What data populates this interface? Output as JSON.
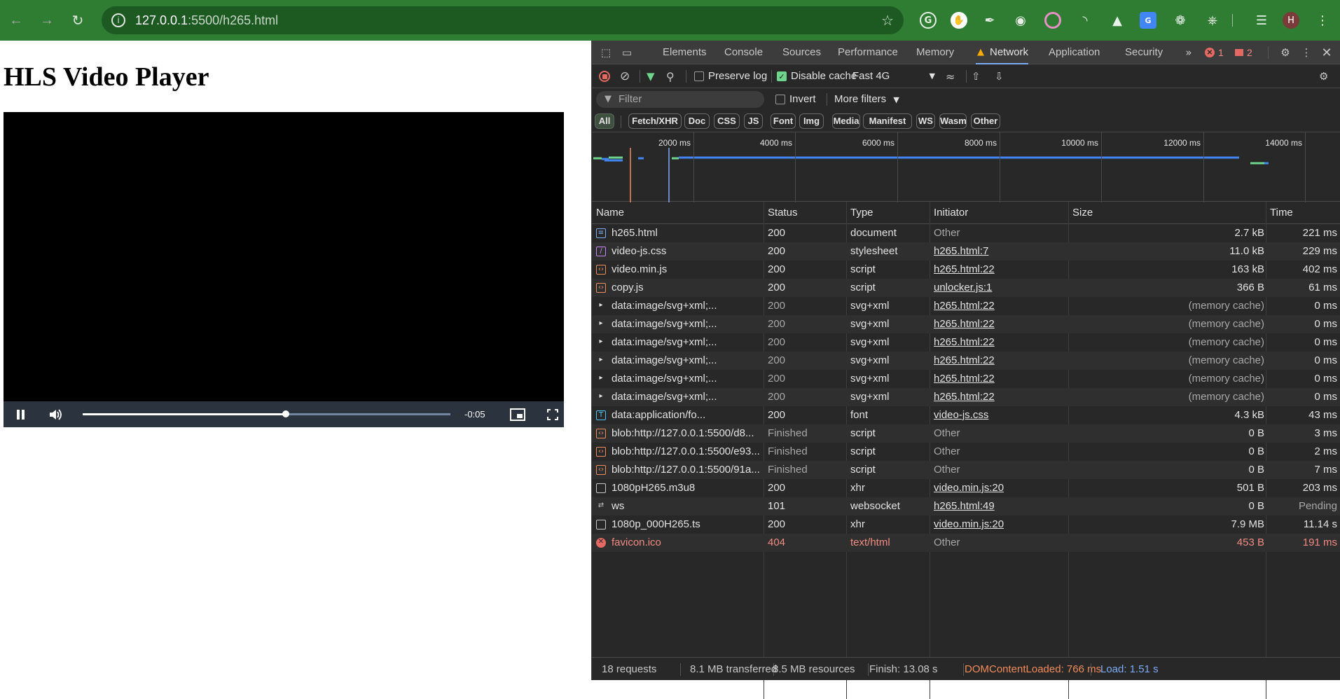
{
  "browser": {
    "url_host": "127.0.0.1",
    "url_path": ":5500/h265.html",
    "avatar_letter": "H"
  },
  "page": {
    "heading": "HLS Video Player",
    "video": {
      "time_remaining": "-0:05",
      "progress_fraction": 0.553
    }
  },
  "devtools": {
    "tabs": [
      "Elements",
      "Console",
      "Sources",
      "Performance",
      "Memory",
      "Network",
      "Application",
      "Security"
    ],
    "active_tab": "Network",
    "error_count": "1",
    "issue_count": "2",
    "toolbar": {
      "preserve_log": "Preserve log",
      "disable_cache": "Disable cache",
      "throttle": "Fast 4G"
    },
    "filter": {
      "placeholder": "Filter",
      "invert": "Invert",
      "more_filters": "More filters"
    },
    "type_filters": [
      "All",
      "Fetch/XHR",
      "Doc",
      "CSS",
      "JS",
      "Font",
      "Img",
      "Media",
      "Manifest",
      "WS",
      "Wasm",
      "Other"
    ],
    "overview_ticks": [
      "2000 ms",
      "4000 ms",
      "6000 ms",
      "8000 ms",
      "10000 ms",
      "12000 ms",
      "14000 ms"
    ],
    "columns": [
      "Name",
      "Status",
      "Type",
      "Initiator",
      "Size",
      "Time"
    ],
    "requests": [
      {
        "name": "h265.html",
        "status": "200",
        "type": "document",
        "initiator": "Other",
        "size": "2.7 kB",
        "time": "221 ms",
        "icon": "doc"
      },
      {
        "name": "video-js.css",
        "status": "200",
        "type": "stylesheet",
        "initiator": "h265.html:7",
        "size": "11.0 kB",
        "time": "229 ms",
        "icon": "css"
      },
      {
        "name": "video.min.js",
        "status": "200",
        "type": "script",
        "initiator": "h265.html:22",
        "size": "163 kB",
        "time": "402 ms",
        "icon": "js"
      },
      {
        "name": "copy.js",
        "status": "200",
        "type": "script",
        "initiator": "unlocker.js:1",
        "size": "366 B",
        "time": "61 ms",
        "icon": "js"
      },
      {
        "name": "data:image/svg+xml;...",
        "status": "200",
        "type": "svg+xml",
        "initiator": "h265.html:22",
        "size": "(memory cache)",
        "time": "0 ms",
        "icon": "svg"
      },
      {
        "name": "data:image/svg+xml;...",
        "status": "200",
        "type": "svg+xml",
        "initiator": "h265.html:22",
        "size": "(memory cache)",
        "time": "0 ms",
        "icon": "svg"
      },
      {
        "name": "data:image/svg+xml;...",
        "status": "200",
        "type": "svg+xml",
        "initiator": "h265.html:22",
        "size": "(memory cache)",
        "time": "0 ms",
        "icon": "svg"
      },
      {
        "name": "data:image/svg+xml;...",
        "status": "200",
        "type": "svg+xml",
        "initiator": "h265.html:22",
        "size": "(memory cache)",
        "time": "0 ms",
        "icon": "svg"
      },
      {
        "name": "data:image/svg+xml;...",
        "status": "200",
        "type": "svg+xml",
        "initiator": "h265.html:22",
        "size": "(memory cache)",
        "time": "0 ms",
        "icon": "svg"
      },
      {
        "name": "data:image/svg+xml;...",
        "status": "200",
        "type": "svg+xml",
        "initiator": "h265.html:22",
        "size": "(memory cache)",
        "time": "0 ms",
        "icon": "svg"
      },
      {
        "name": "data:application/fo...",
        "status": "200",
        "type": "font",
        "initiator": "video-js.css",
        "size": "4.3 kB",
        "time": "43 ms",
        "icon": "font"
      },
      {
        "name": "blob:http://127.0.0.1:5500/d8...",
        "status": "Finished",
        "type": "script",
        "initiator": "Other",
        "size": "0 B",
        "time": "3 ms",
        "icon": "js"
      },
      {
        "name": "blob:http://127.0.0.1:5500/e93...",
        "status": "Finished",
        "type": "script",
        "initiator": "Other",
        "size": "0 B",
        "time": "2 ms",
        "icon": "js"
      },
      {
        "name": "blob:http://127.0.0.1:5500/91a...",
        "status": "Finished",
        "type": "script",
        "initiator": "Other",
        "size": "0 B",
        "time": "7 ms",
        "icon": "js"
      },
      {
        "name": "1080pH265.m3u8",
        "status": "200",
        "type": "xhr",
        "initiator": "video.min.js:20",
        "size": "501 B",
        "time": "203 ms",
        "icon": "file"
      },
      {
        "name": "ws",
        "status": "101",
        "type": "websocket",
        "initiator": "h265.html:49",
        "size": "0 B",
        "time": "Pending",
        "icon": "ws"
      },
      {
        "name": "1080p_000H265.ts",
        "status": "200",
        "type": "xhr",
        "initiator": "video.min.js:20",
        "size": "7.9 MB",
        "time": "11.14 s",
        "icon": "file"
      },
      {
        "name": "favicon.ico",
        "status": "404",
        "type": "text/html",
        "initiator": "Other",
        "size": "453 B",
        "time": "191 ms",
        "icon": "error"
      }
    ],
    "summary": {
      "requests": "18 requests",
      "transferred": "8.1 MB transferred",
      "resources": "8.5 MB resources",
      "finish": "Finish: 13.08 s",
      "dcl": "DOMContentLoaded: 766 ms",
      "load": "Load: 1.51 s"
    }
  }
}
